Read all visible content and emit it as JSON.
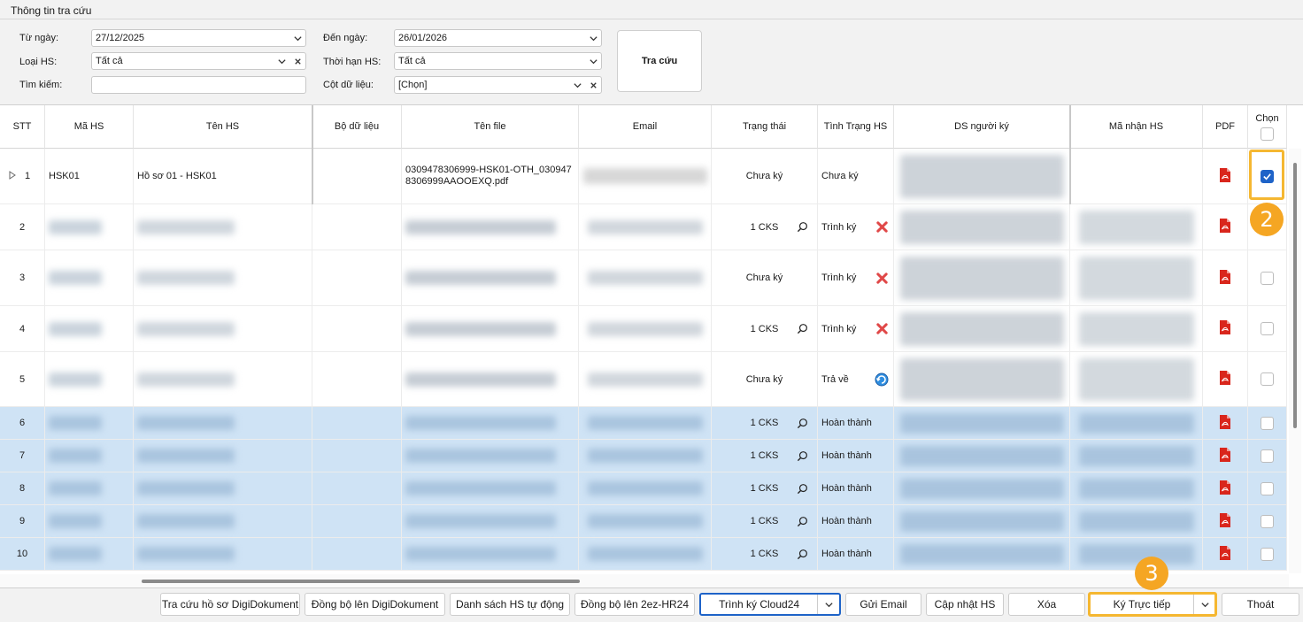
{
  "window": {
    "title": "Thông tin tra cứu"
  },
  "filters": {
    "from_label": "Từ ngày:",
    "from_value": "27/12/2025",
    "to_label": "Đến ngày:",
    "to_value": "26/01/2026",
    "type_label": "Loại HS:",
    "type_value": "Tất cả",
    "term_label": "Thời hạn HS:",
    "term_value": "Tất cả",
    "search_label": "Tìm kiếm:",
    "search_value": "",
    "cols_label": "Cột dữ liệu:",
    "cols_value": "[Chọn]",
    "search_button": "Tra cứu"
  },
  "table": {
    "headers": [
      "STT",
      "Mã HS",
      "Tên HS",
      "Bộ dữ liệu",
      "Tên file",
      "Email",
      "Trạng thái",
      "Tình Trạng HS",
      "DS người ký",
      "Mã nhận HS",
      "PDF",
      "Chọn"
    ],
    "rows": [
      {
        "stt": "1",
        "ma": "HSK01",
        "ten": "Hồ sơ 01 - HSK01",
        "file": "0309478306999-HSK01-OTH_0309478306999AAOOEXQ.pdf",
        "trangthai": "Chưa ký",
        "tinhtrang": "Chưa ký",
        "status_icon": "none",
        "search": false,
        "checked": true,
        "selected": false
      },
      {
        "stt": "2",
        "trangthai": "1 CKS",
        "tinhtrang": "Trình ký",
        "status_icon": "red-x-icon",
        "search": true,
        "checked": false,
        "selected": false
      },
      {
        "stt": "3",
        "trangthai": "Chưa ký",
        "tinhtrang": "Trình ký",
        "status_icon": "red-x-icon",
        "search": false,
        "checked": false,
        "selected": false
      },
      {
        "stt": "4",
        "trangthai": "1 CKS",
        "tinhtrang": "Trình ký",
        "status_icon": "red-x-icon",
        "search": true,
        "checked": false,
        "selected": false
      },
      {
        "stt": "5",
        "trangthai": "Chưa ký",
        "tinhtrang": "Trả về",
        "status_icon": "return-icon",
        "search": false,
        "checked": false,
        "selected": false
      },
      {
        "stt": "6",
        "trangthai": "1 CKS",
        "tinhtrang": "Hoàn thành",
        "status_icon": "none",
        "search": true,
        "checked": false,
        "selected": true
      },
      {
        "stt": "7",
        "trangthai": "1 CKS",
        "tinhtrang": "Hoàn thành",
        "status_icon": "none",
        "search": true,
        "checked": false,
        "selected": true
      },
      {
        "stt": "8",
        "trangthai": "1 CKS",
        "tinhtrang": "Hoàn thành",
        "status_icon": "none",
        "search": true,
        "checked": false,
        "selected": true
      },
      {
        "stt": "9",
        "trangthai": "1 CKS",
        "tinhtrang": "Hoàn thành",
        "status_icon": "none",
        "search": true,
        "checked": false,
        "selected": true
      },
      {
        "stt": "10",
        "trangthai": "1 CKS",
        "tinhtrang": "Hoàn thành",
        "status_icon": "none",
        "search": true,
        "checked": false,
        "selected": true
      }
    ]
  },
  "buttons": {
    "lookup_digi": "Tra cứu hồ sơ DigiDokument",
    "sync_digi": "Đồng bộ lên DigiDokument",
    "auto_list": "Danh sách HS tự động",
    "sync_2ez": "Đồng bộ lên 2ez-HR24",
    "cloud24": "Trình ký Cloud24",
    "email": "Gửi Email",
    "update": "Cập nhật HS",
    "delete": "Xóa",
    "sign_direct": "Ký Trực tiếp",
    "exit": "Thoát"
  },
  "annotations": {
    "badge_2": "2",
    "badge_3": "3"
  },
  "colors": {
    "selection": "#cfe3f5",
    "accent": "#1e63c8",
    "badge": "#f5a623",
    "highlight": "#f5b731"
  }
}
